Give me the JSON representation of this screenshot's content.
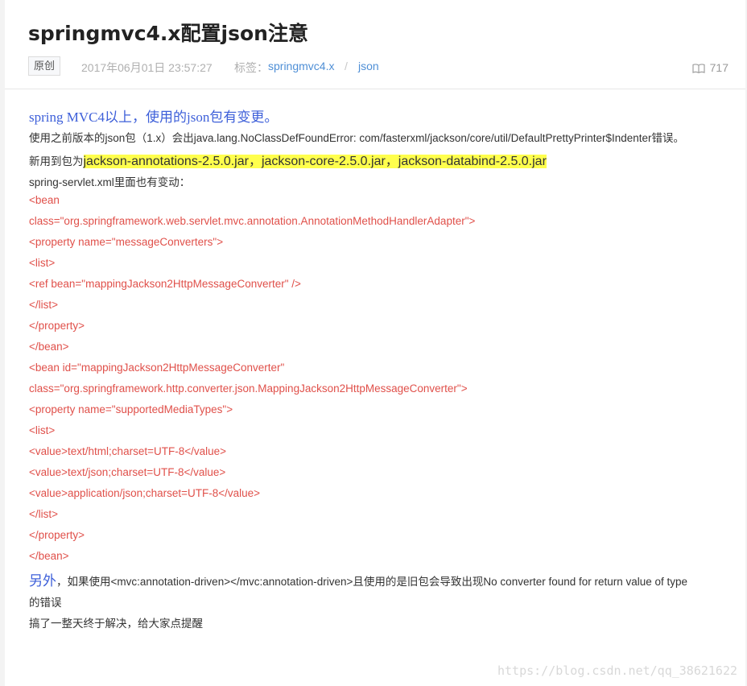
{
  "article": {
    "title": "springmvc4.x配置json注意",
    "badge": "原创",
    "date": "2017年06月01日 23:57:27",
    "tags_label": "标签：",
    "tags": [
      "springmvc4.x",
      "json"
    ],
    "tag_separator": "/",
    "views": "717",
    "icons": {
      "views": "book-icon"
    }
  },
  "content": {
    "intro_en": "spring MVC4",
    "intro_cn": "以上，使用的",
    "intro_json": "json",
    "intro_cn2": "包有变更。",
    "error_line": "使用之前版本的json包（1.x）会出java.lang.NoClassDefFoundError: com/fasterxml/jackson/core/util/DefaultPrettyPrinter$Indenter错误。",
    "new_pkg_prefix": "新用到包为",
    "new_pkg_list": "jackson-annotations-2.5.0.jar，jackson-core-2.5.0.jar，jackson-databind-2.5.0.jar",
    "servlet_line": "spring-servlet.xml里面也有变动：",
    "code_lines": [
      "<bean",
      "class=\"org.springframework.web.servlet.mvc.annotation.AnnotationMethodHandlerAdapter\">",
      "<property name=\"messageConverters\">",
      "<list>",
      "<ref bean=\"mappingJackson2HttpMessageConverter\" />",
      "</list>",
      "</property>",
      "</bean>",
      "<bean id=\"mappingJackson2HttpMessageConverter\"",
      "class=\"org.springframework.http.converter.json.MappingJackson2HttpMessageConverter\">",
      "<property name=\"supportedMediaTypes\">",
      "<list>",
      "<value>text/html;charset=UTF-8</value>",
      "<value>text/json;charset=UTF-8</value>",
      "<value>application/json;charset=UTF-8</value>",
      "</list>",
      "</property>",
      "</bean>"
    ],
    "also_word": "另外",
    "also_text": "，如果使用<mvc:annotation-driven></mvc:annotation-driven>且使用的是旧包会导致出现No converter found for return value of type",
    "also_text2": "的错误",
    "closing": "搞了一整天终于解决，给大家点提醒"
  },
  "watermark": "https://blog.csdn.net/qq_38621622"
}
